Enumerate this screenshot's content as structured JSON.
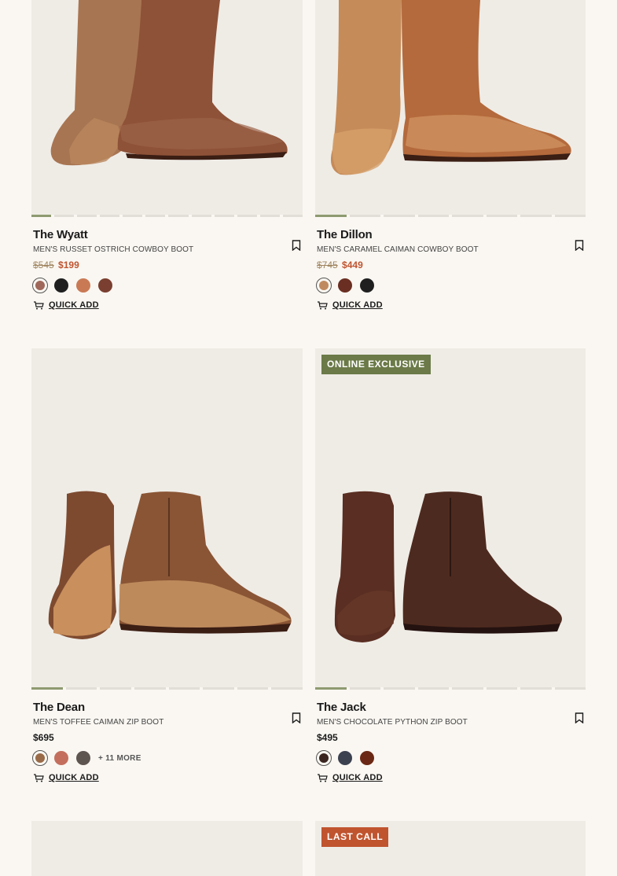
{
  "products": [
    {
      "name": "The Wyatt",
      "subtitle": "MEN'S RUSSET OSTRICH COWBOY BOOT",
      "price_was": "$545",
      "price_now": "$199",
      "swatches": [
        "#a0685a",
        "#1f1f1f",
        "#c97a55",
        "#7a3f30"
      ],
      "quick_add": "QUICK ADD",
      "carousel_slides": 12,
      "carousel_active": 0
    },
    {
      "name": "The Dillon",
      "subtitle": "MEN'S CARAMEL CAIMAN COWBOY BOOT",
      "price_was": "$745",
      "price_now": "$449",
      "swatches": [
        "#c08a60",
        "#6a2e22",
        "#1f1f1f"
      ],
      "quick_add": "QUICK ADD",
      "carousel_slides": 8,
      "carousel_active": 0
    },
    {
      "name": "The Dean",
      "subtitle": "MEN'S TOFFEE CAIMAN ZIP BOOT",
      "price": "$695",
      "swatches": [
        "#9a6b48",
        "#c46f5e",
        "#5e5450"
      ],
      "more": "+ 11 MORE",
      "quick_add": "QUICK ADD",
      "carousel_slides": 8,
      "carousel_active": 0
    },
    {
      "name": "The Jack",
      "subtitle": "MEN'S CHOCOLATE PYTHON ZIP BOOT",
      "price": "$495",
      "badge": "ONLINE EXCLUSIVE",
      "swatches": [
        "#3a2520",
        "#3c4150",
        "#6a2814"
      ],
      "quick_add": "QUICK ADD",
      "carousel_slides": 8,
      "carousel_active": 0
    },
    {
      "badge": "LAST CALL"
    }
  ],
  "colors": {
    "sale": "#c0542f",
    "badge_green": "#6b7a48",
    "badge_orange": "#c0542f",
    "carousel_active": "#8e9a70"
  },
  "icons": {
    "bookmark": "bookmark-icon",
    "quick_add": "cart-icon"
  }
}
